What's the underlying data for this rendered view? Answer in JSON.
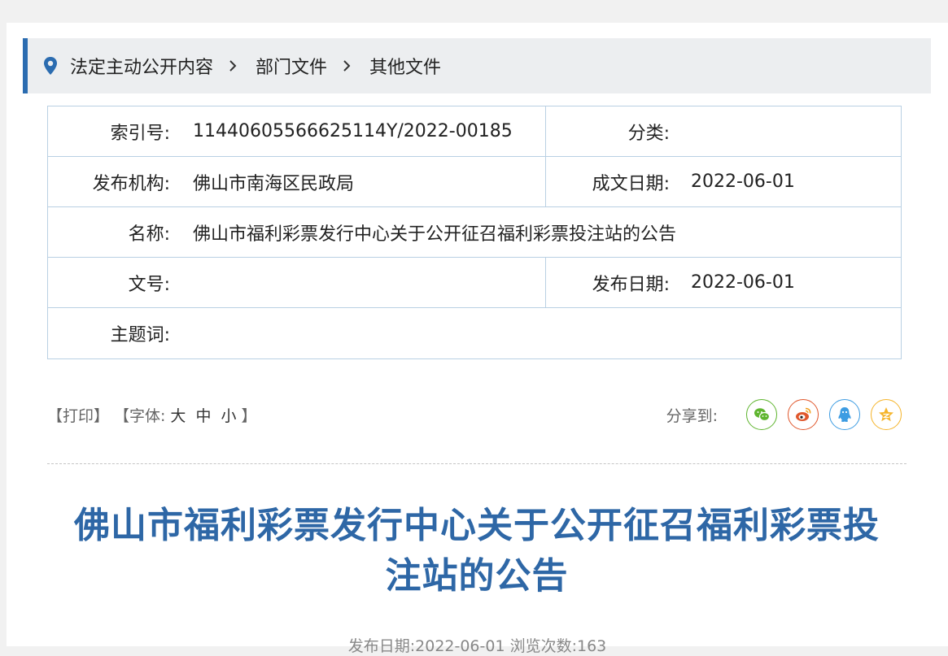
{
  "breadcrumb": {
    "items": [
      "法定主动公开内容",
      "部门文件",
      "其他文件"
    ]
  },
  "meta": {
    "index_label": "索引号:",
    "index_value": "11440605566625114Y/2022-00185",
    "category_label": "分类:",
    "category_value": "",
    "publisher_label": "发布机构:",
    "publisher_value": "佛山市南海区民政局",
    "written_date_label": "成文日期:",
    "written_date_value": "2022-06-01",
    "name_label": "名称:",
    "name_value": "佛山市福利彩票发行中心关于公开征召福利彩票投注站的公告",
    "doc_no_label": "文号:",
    "doc_no_value": "",
    "publish_date_label": "发布日期:",
    "publish_date_value": "2022-06-01",
    "subject_label": "主题词:",
    "subject_value": ""
  },
  "tools": {
    "print": "【打印】",
    "font_open": "【字体:",
    "font_large": "大",
    "font_medium": "中",
    "font_small": "小",
    "font_close": "】",
    "share_label": "分享到:"
  },
  "icons": {
    "wechat": "wechat-icon",
    "weibo": "weibo-icon",
    "qq": "qq-icon",
    "qzone": "qzone-icon"
  },
  "colors": {
    "accent": "#2b6cb0",
    "title": "#2e67a6",
    "wechat": "#5fb52f",
    "weibo": "#e0572c",
    "qq": "#3d9ce2",
    "qzone": "#f5b42a"
  },
  "article": {
    "title_line1": "佛山市福利彩票发行中心关于公开征召福利彩票投",
    "title_line2": "注站的公告",
    "pub_info": "发布日期:2022-06-01  浏览次数:163"
  }
}
